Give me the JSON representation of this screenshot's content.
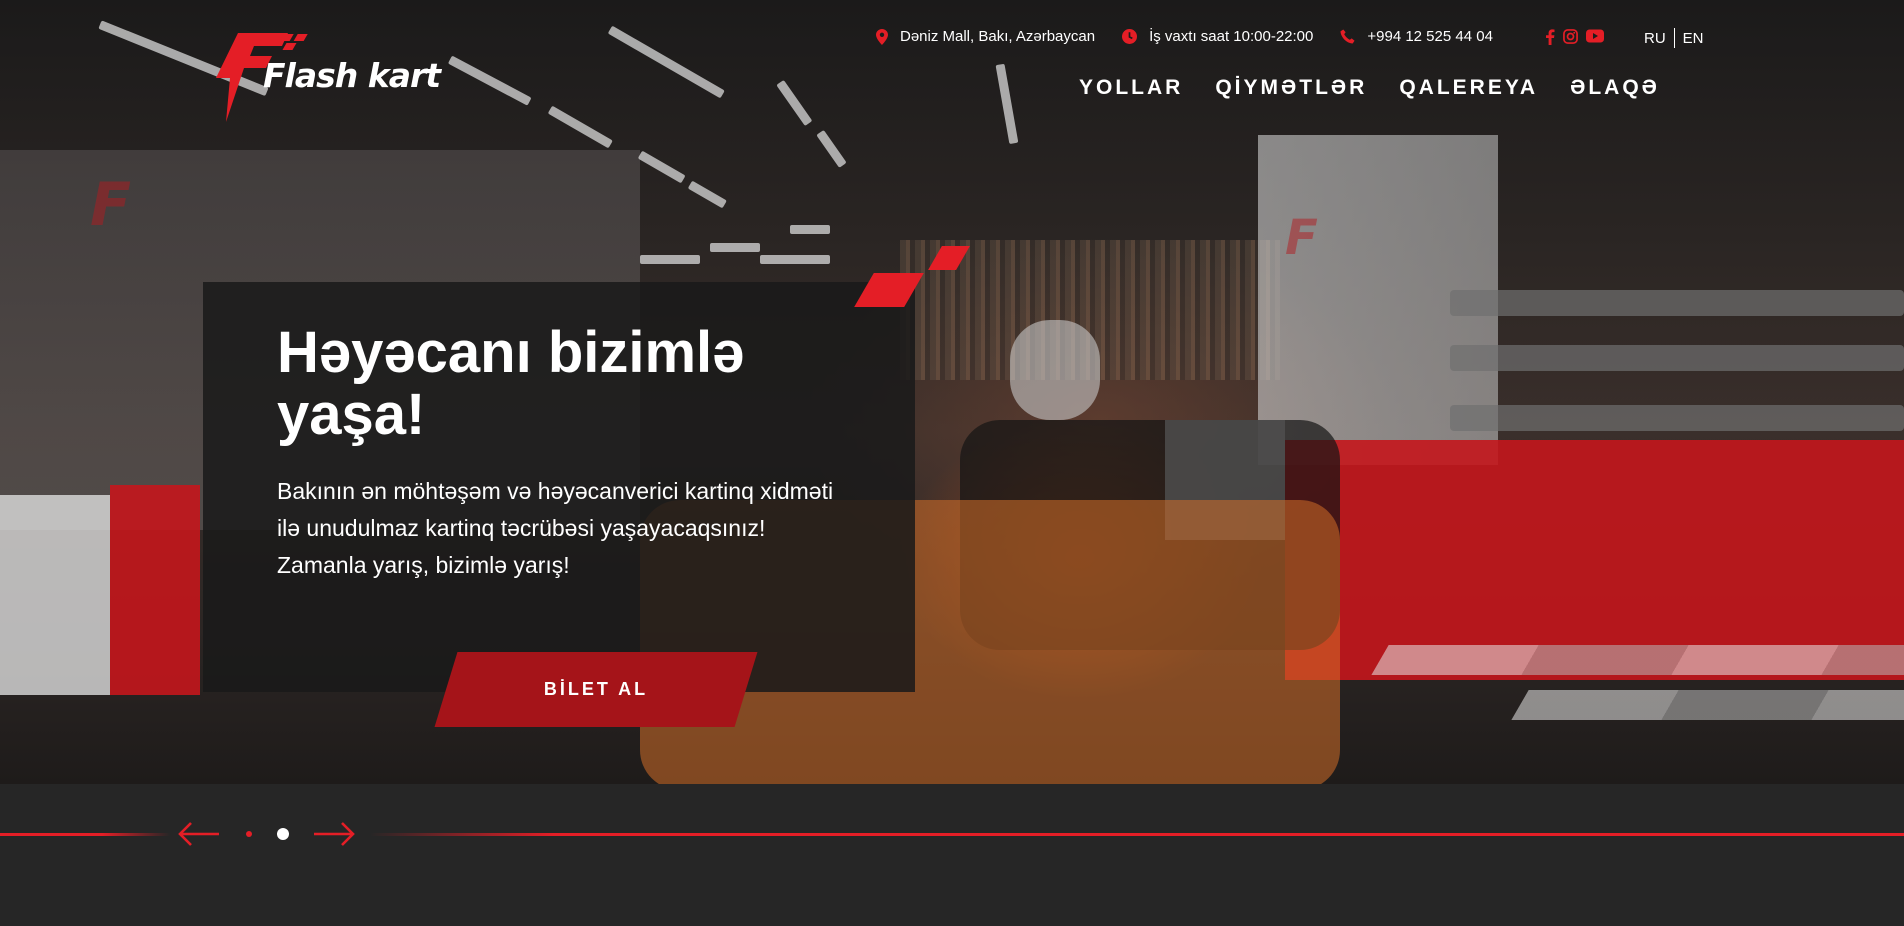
{
  "brand": {
    "name": "Flash kart",
    "accent_color": "#e41e26",
    "button_color": "#a51419",
    "background_color": "#262626"
  },
  "header": {
    "contacts": [
      {
        "icon": "location-pin-icon",
        "text": "Dəniz Mall, Bakı, Azərbaycan"
      },
      {
        "icon": "clock-icon",
        "text": "İş vaxtı saat 10:00-22:00"
      },
      {
        "icon": "phone-icon",
        "text": "+994 12 525 44 04"
      }
    ],
    "social": [
      "facebook-icon",
      "instagram-icon",
      "youtube-icon"
    ],
    "languages": [
      "RU",
      "EN"
    ],
    "nav": [
      "YOLLAR",
      "QİYMƏTLƏR",
      "QALEREYA",
      "ƏLAQƏ"
    ]
  },
  "hero": {
    "title": "Həyəcanı bizimlə yaşa!",
    "text": "Bakının ən möhtəşəm və həyəcanverici kartinq xidməti ilə unudulmaz kartinq təcrübəsi yaşayacaqsınız!\nZamanla yarış, bizimlə yarış!",
    "cta": "BİLET AL"
  },
  "slider": {
    "prev_icon": "arrow-left-icon",
    "next_icon": "arrow-right-icon",
    "slide_count": 2,
    "active_slide": 2
  }
}
